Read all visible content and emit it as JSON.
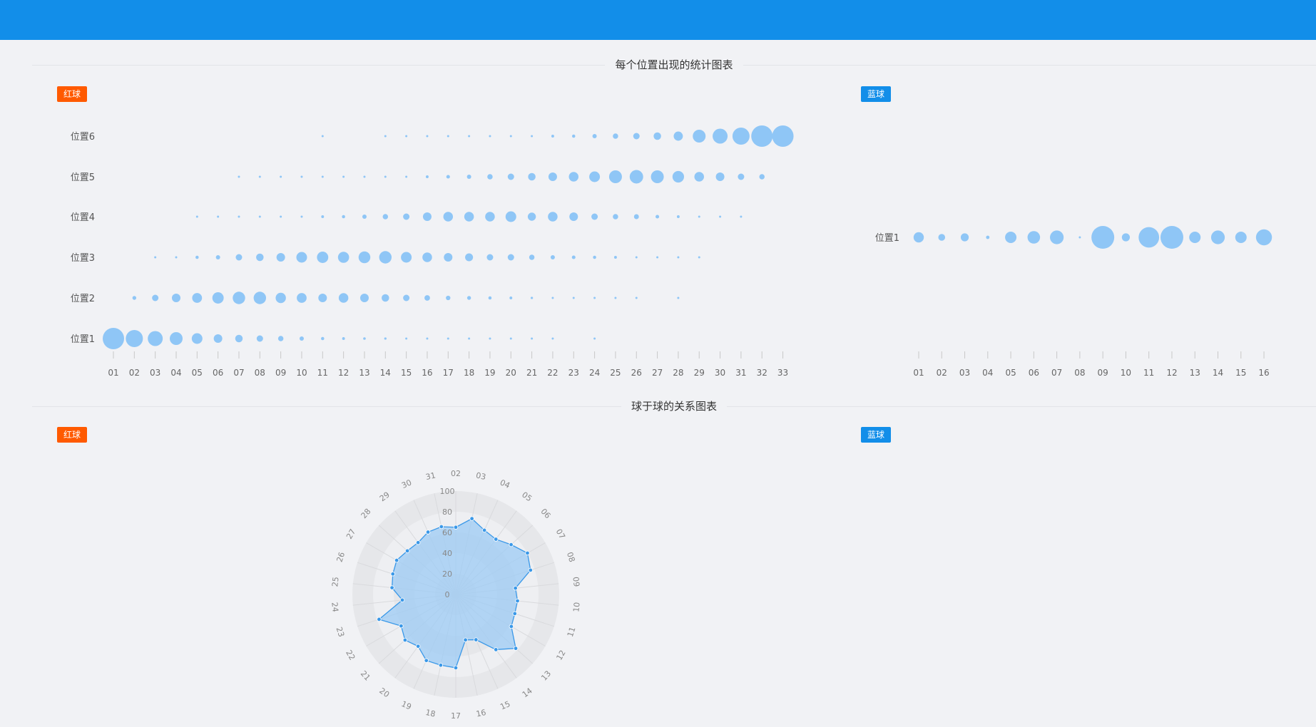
{
  "colors": {
    "topbar": "#128ee9",
    "red_tag": "#ff5a00",
    "blue_tag": "#128ee9",
    "bubble": "#8fc6f6",
    "radar_stroke": "#3a98e8",
    "radar_fill": "#9ccbf4"
  },
  "section1": {
    "title": "每个位置出现的统计图表"
  },
  "section2": {
    "title": "球于球的关系图表"
  },
  "tags": {
    "red": "红球",
    "blue": "蓝球"
  },
  "chart_data": [
    {
      "type": "scatter",
      "subtype": "bubble",
      "x": [
        "01",
        "02",
        "03",
        "04",
        "05",
        "06",
        "07",
        "08",
        "09",
        "10",
        "11",
        "12",
        "13",
        "14",
        "15",
        "16",
        "17",
        "18",
        "19",
        "20",
        "21",
        "22",
        "23",
        "24",
        "25",
        "26",
        "27",
        "28",
        "29",
        "30",
        "31",
        "32",
        "33"
      ],
      "y": [
        "位置1",
        "位置2",
        "位置3",
        "位置4",
        "位置5",
        "位置6"
      ],
      "series": [
        {
          "name": "位置1",
          "values": [
            10,
            8,
            7,
            6,
            5,
            4,
            3.5,
            3,
            2.5,
            2,
            1.5,
            1.3,
            1.2,
            1.1,
            1,
            0.9,
            0.8,
            0.7,
            0.6,
            0.6,
            0.5,
            0.5,
            0,
            0.4,
            0,
            0,
            0,
            0,
            0,
            0,
            0,
            0,
            0
          ]
        },
        {
          "name": "位置2",
          "values": [
            0,
            1.8,
            3,
            4,
            4.6,
            5.3,
            5.8,
            5.8,
            4.8,
            4.6,
            4,
            4.5,
            4,
            3.5,
            3,
            2.6,
            2.1,
            1.8,
            1.5,
            1.3,
            1.1,
            1,
            0.9,
            0.8,
            0.7,
            0.6,
            0,
            0.4,
            0,
            0,
            0,
            0,
            0
          ]
        },
        {
          "name": "位置3",
          "values": [
            0,
            0,
            0.5,
            1,
            1.5,
            2,
            3,
            3.5,
            4,
            5,
            5.3,
            5.2,
            5.5,
            5.8,
            5,
            4.5,
            4,
            3.7,
            3,
            3,
            2.5,
            2,
            1.7,
            1.5,
            1.3,
            1,
            0.9,
            0.8,
            0.6,
            0,
            0,
            0,
            0
          ]
        },
        {
          "name": "位置4",
          "values": [
            0,
            0,
            0,
            0,
            0.5,
            0.5,
            0.6,
            0.7,
            0.8,
            1,
            1.3,
            1.5,
            2,
            2.5,
            3,
            4,
            4.5,
            4.5,
            4.5,
            5,
            3.8,
            4.5,
            4,
            3,
            2.5,
            2.3,
            1.7,
            1.3,
            1,
            0.8,
            0.7,
            0,
            0
          ]
        },
        {
          "name": "位置5",
          "values": [
            0,
            0,
            0,
            0,
            0,
            0,
            0.5,
            0.5,
            0.5,
            0.6,
            0.6,
            0.6,
            0.7,
            0.8,
            1,
            1.3,
            1.7,
            2,
            2.5,
            3,
            3.5,
            4,
            4.5,
            5,
            6,
            6.3,
            6,
            5.4,
            4.5,
            4,
            3,
            2.5,
            0
          ]
        },
        {
          "name": "位置6",
          "values": [
            0,
            0,
            0,
            0,
            0,
            0,
            0,
            0,
            0,
            0,
            0.5,
            0,
            0,
            0.5,
            0.6,
            0.6,
            0.7,
            0.8,
            0.8,
            0.9,
            1,
            1.3,
            1.5,
            2,
            2.5,
            3,
            3.5,
            4.3,
            6,
            7,
            8,
            10,
            10
          ]
        }
      ]
    },
    {
      "type": "scatter",
      "subtype": "bubble",
      "x": [
        "01",
        "02",
        "03",
        "04",
        "05",
        "06",
        "07",
        "08",
        "09",
        "10",
        "11",
        "12",
        "13",
        "14",
        "15",
        "16"
      ],
      "y": [
        "位置1"
      ],
      "series": [
        {
          "name": "位置1",
          "values": [
            4.5,
            3,
            3.5,
            1.5,
            5,
            5.5,
            6,
            0.8,
            10,
            3.5,
            9,
            10,
            5,
            6,
            5,
            7
          ]
        }
      ]
    },
    {
      "type": "radar",
      "radial_ticks": [
        "0",
        "20",
        "40",
        "60",
        "80",
        "100"
      ],
      "rmax": 100,
      "categories": [
        "02",
        "03",
        "04",
        "05",
        "06",
        "07",
        "08",
        "09",
        "10",
        "11",
        "12",
        "13",
        "14",
        "15",
        "16",
        "17",
        "18",
        "19",
        "20",
        "21",
        "22",
        "23",
        "24",
        "25",
        "26",
        "27",
        "28",
        "29",
        "30",
        "31"
      ],
      "values": [
        65,
        75,
        68,
        66,
        72,
        80,
        76,
        58,
        60,
        60,
        62,
        78,
        66,
        48,
        45,
        71,
        70,
        70,
        62,
        66,
        61,
        78,
        52,
        62,
        64,
        66,
        63,
        62,
        66,
        67
      ]
    }
  ]
}
